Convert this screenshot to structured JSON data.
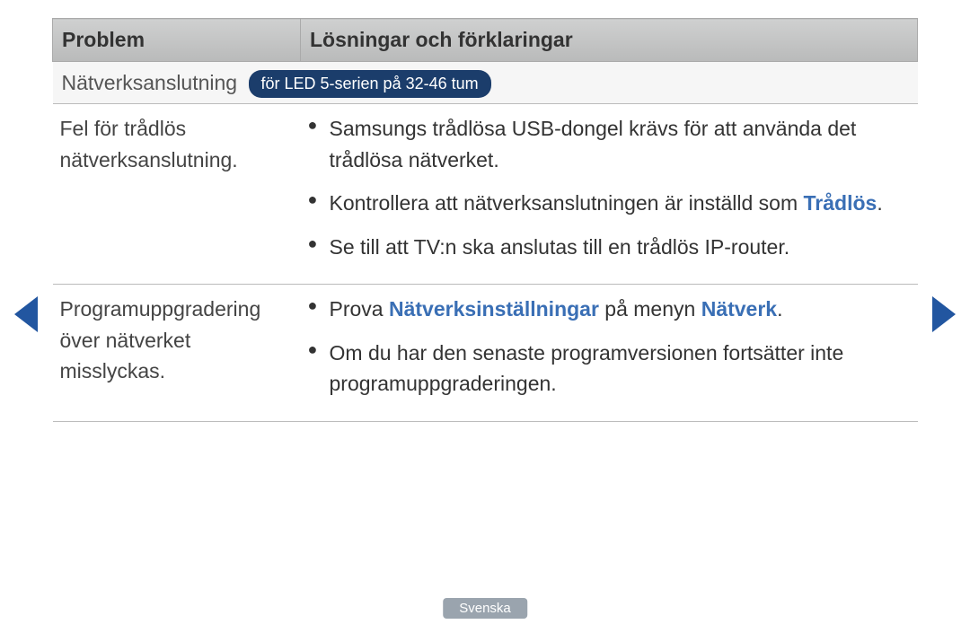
{
  "headers": {
    "problem": "Problem",
    "solution": "Lösningar och förklaringar"
  },
  "section": {
    "title": "Nätverksanslutning",
    "badge": "för LED 5-serien på 32-46 tum"
  },
  "rows": [
    {
      "problem": "Fel för trådlös nätverksanslutning.",
      "bullets": [
        {
          "pre": "Samsungs trådlösa USB-dongel krävs för att använda det trådlösa nätverket."
        },
        {
          "pre": "Kontrollera att nätverksanslutningen är inställd som ",
          "hl1": "Trådlös",
          "post1": "."
        },
        {
          "pre": "Se till att TV:n ska anslutas till en trådlös IP-router."
        }
      ]
    },
    {
      "problem": "Programuppgradering över nätverket misslyckas.",
      "bullets": [
        {
          "pre": "Prova ",
          "hl1": "Nätverksinställningar",
          "mid": " på menyn ",
          "hl2": "Nätverk",
          "post2": "."
        },
        {
          "pre": "Om du har den senaste programversionen fortsätter inte programuppgraderingen."
        }
      ]
    }
  ],
  "footer": {
    "language": "Svenska"
  }
}
